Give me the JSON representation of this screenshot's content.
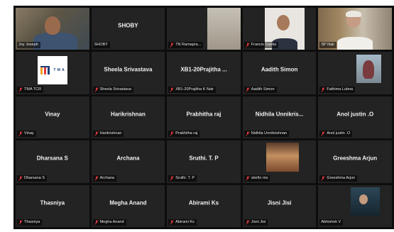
{
  "app": "Video conference gallery view",
  "accent": {
    "active_speaker_border": "#d8e02b",
    "mute_icon": "#e0383e",
    "tile_bg": "#232323"
  },
  "participants": [
    {
      "center_name": "",
      "label": "Joy Joseph",
      "muted": false,
      "video": true
    },
    {
      "center_name": "SHOBY",
      "label": "SHOBY",
      "muted": false,
      "video": false
    },
    {
      "center_name": "",
      "label": "TN Ramapra...",
      "muted": true,
      "video": true
    },
    {
      "center_name": "",
      "label": "Francis Dabbs",
      "muted": true,
      "video": true
    },
    {
      "center_name": "",
      "label": "SP Nair",
      "muted": false,
      "video": true
    },
    {
      "center_name": "",
      "label": "TMA TCR",
      "muted": true,
      "video": true,
      "logo_text": "T M A"
    },
    {
      "center_name": "Sheela Srivastava",
      "label": "Sheela Srivastava",
      "muted": true,
      "video": false
    },
    {
      "center_name": "XB1-20Prajitha ...",
      "label": "XB1-20Prajitha K Nair",
      "muted": true,
      "video": false
    },
    {
      "center_name": "Aadith Simon",
      "label": "Aadith Simon",
      "muted": true,
      "video": false
    },
    {
      "center_name": "",
      "label": "Fathima Lubna",
      "muted": true,
      "video": true
    },
    {
      "center_name": "Vinay",
      "label": "Vinay",
      "muted": true,
      "video": false
    },
    {
      "center_name": "Harikrishnan",
      "label": "Harikrishnan",
      "muted": true,
      "video": false
    },
    {
      "center_name": "Prabhitha raj",
      "label": "Prabhitha raj",
      "muted": true,
      "video": false
    },
    {
      "center_name": "Nidhila Unnikris...",
      "label": "Nidhila Unnikrishnan",
      "muted": true,
      "video": false
    },
    {
      "center_name": "Anol justin .O",
      "label": "Anol justin .O",
      "muted": true,
      "video": false
    },
    {
      "center_name": "Dharsana S",
      "label": "Dharsana S",
      "muted": true,
      "video": false
    },
    {
      "center_name": "Archana",
      "label": "Archana",
      "muted": true,
      "video": false
    },
    {
      "center_name": "Sruthi. T. P",
      "label": "Sruthi. T. P",
      "muted": true,
      "video": false
    },
    {
      "center_name": "",
      "label": "sterlin ms",
      "muted": true,
      "video": true
    },
    {
      "center_name": "Greeshma Arjun",
      "label": "Greeshma Arjun",
      "muted": true,
      "video": false
    },
    {
      "center_name": "Thasniya",
      "label": "Thasniya",
      "muted": true,
      "video": false
    },
    {
      "center_name": "Megha Anand",
      "label": "Megha Anand",
      "muted": true,
      "video": false
    },
    {
      "center_name": "Abirami Ks",
      "label": "Abirami Ks",
      "muted": true,
      "video": false
    },
    {
      "center_name": "Jisni Jisi",
      "label": "Jisni Jisi",
      "muted": true,
      "video": false
    },
    {
      "center_name": "",
      "label": "Abhishek V",
      "muted": false,
      "video": true
    }
  ]
}
